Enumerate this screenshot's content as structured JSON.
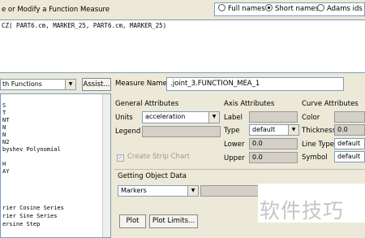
{
  "window": {
    "title": "e or Modify a Function Measure"
  },
  "name_display": {
    "options": [
      "Full names",
      "Short names",
      "Adams ids"
    ],
    "selected": "Short names"
  },
  "function_text": "CZ( PART6.cm, MARKER_25, PART6.cm, MARKER_25)",
  "left_panel": {
    "category_select": "th Functions",
    "assist_button": "Assist...",
    "function_list": [
      "S",
      "T",
      "NT",
      "N",
      "N",
      "N2",
      "byshev Polynomial",
      "",
      "H",
      "AY",
      "",
      "",
      "rier Cosine Series",
      "rier Sine Series",
      "ersine Step"
    ]
  },
  "measure_name": {
    "label": "Measure Name",
    "value": ".joint_3.FUNCTION_MEA_1"
  },
  "general_attributes": {
    "heading": "General Attributes",
    "units_label": "Units",
    "units_value": "acceleration",
    "legend_label": "Legend",
    "legend_value": ""
  },
  "axis_attributes": {
    "heading": "Axis Attributes",
    "label_label": "Label",
    "type_label": "Type",
    "type_value": "default",
    "lower_label": "Lower",
    "lower_value": "0.0",
    "upper_label": "Upper",
    "upper_value": "0.0"
  },
  "curve_attributes": {
    "heading": "Curve Attributes",
    "color_label": "Color",
    "thickness_label": "Thickness",
    "thickness_value": "0.0",
    "line_type_label": "Line Type",
    "line_type_value": "default",
    "symbol_label": "Symbol",
    "symbol_value": "default"
  },
  "strip_chart": {
    "label": "Create Strip Chart",
    "checked": true,
    "enabled": false
  },
  "object_data": {
    "heading": "Getting Object Data",
    "select_value": "Markers"
  },
  "buttons": {
    "plot": "Plot",
    "plot_limits": "Plot Limits..."
  },
  "watermark": "软件技巧",
  "colors": {
    "background": "#ece9d8",
    "field_border": "#7f9db9",
    "disabled_field": "#d4d0c8"
  }
}
